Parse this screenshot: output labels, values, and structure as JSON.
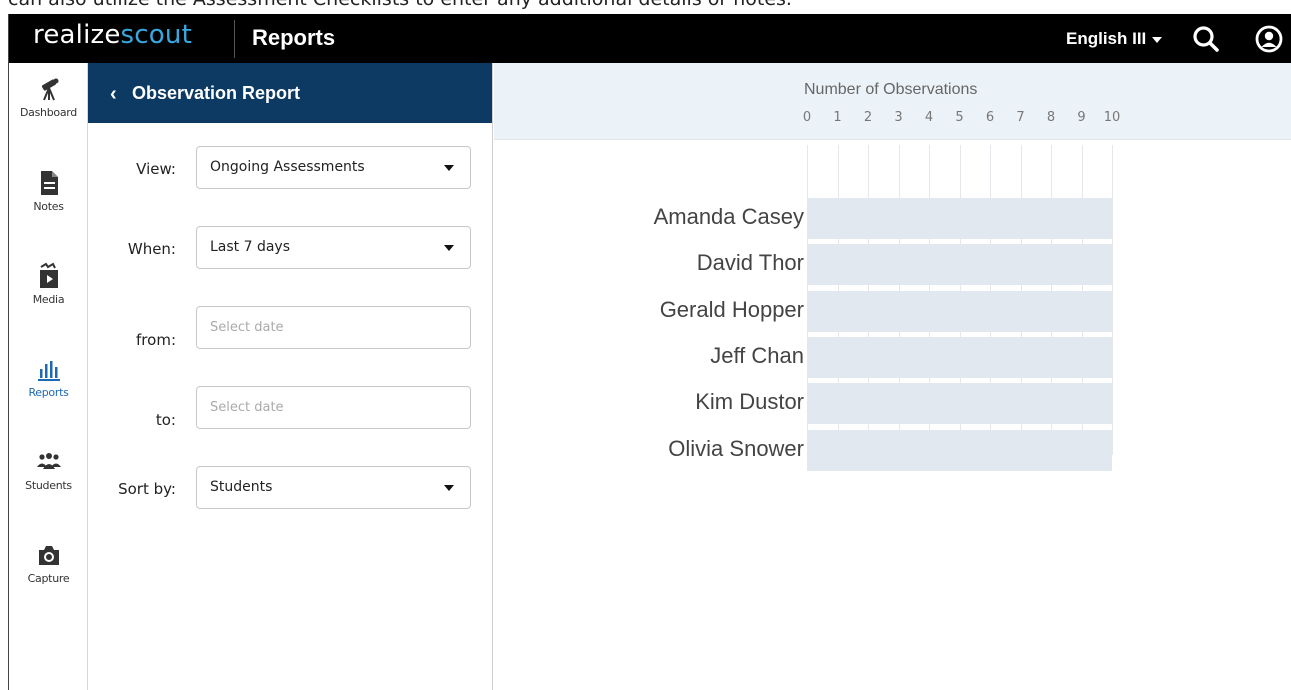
{
  "caption": "can also utilize the Assessment Checklists to enter any additional details or notes.",
  "topbar": {
    "logo_part1": "realize",
    "logo_part2": "scout",
    "app_title": "Reports",
    "class_selector": "English III",
    "search_icon": "search-icon",
    "user_icon": "user-account-icon"
  },
  "nav": {
    "items": [
      {
        "label": "Dashboard",
        "icon": "telescope-icon"
      },
      {
        "label": "Notes",
        "icon": "document-icon"
      },
      {
        "label": "Media",
        "icon": "media-folder-icon"
      },
      {
        "label": "Reports",
        "icon": "bar-chart-icon",
        "active": true
      },
      {
        "label": "Students",
        "icon": "students-group-icon"
      },
      {
        "label": "Capture",
        "icon": "camera-icon"
      }
    ],
    "accent_color": "#1f69b3"
  },
  "panel": {
    "title": "Observation Report",
    "view_label": "View:",
    "view_value": "Ongoing Assessments",
    "when_label": "When:",
    "when_value": "Last 7 days",
    "from_label": "from:",
    "from_placeholder": "Select date",
    "to_label": "to:",
    "to_placeholder": "Select date",
    "sort_label": "Sort by:",
    "sort_value": "Students",
    "header_color": "#0d3a63"
  },
  "chart_data": {
    "type": "bar",
    "orientation": "horizontal",
    "xlabel": "Number of Observations",
    "xlim": [
      0,
      10
    ],
    "xticks": [
      "0",
      "1",
      "2",
      "3",
      "4",
      "5",
      "6",
      "7",
      "8",
      "9",
      "10"
    ],
    "categories": [
      "Amanda Casey",
      "David Thor",
      "Gerald Hopper",
      "Jeff Chan",
      "Kim Dustor",
      "Olivia Snower"
    ],
    "values": [
      0,
      0,
      0,
      0,
      0,
      0
    ],
    "grid": true
  }
}
